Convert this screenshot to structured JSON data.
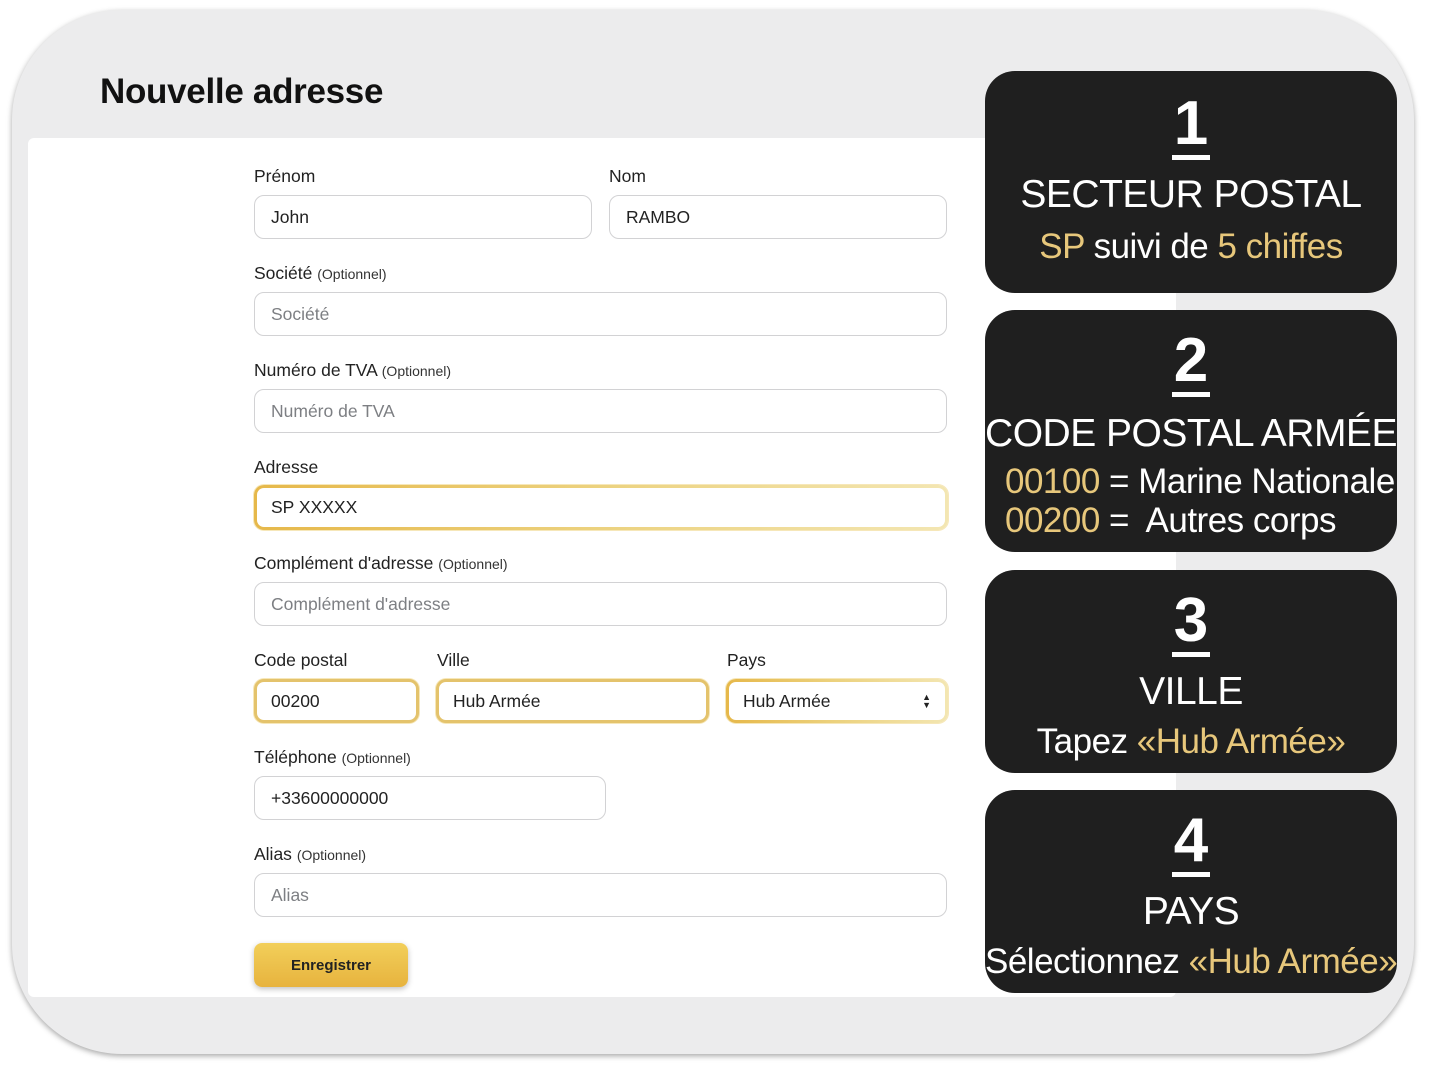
{
  "page": {
    "title": "Nouvelle adresse"
  },
  "colors": {
    "accent_gold": "#e7c77b",
    "card_bg": "#1f1f1f",
    "button_gold": "#ecc04b"
  },
  "form": {
    "firstname": {
      "label": "Prénom",
      "value": "John"
    },
    "lastname": {
      "label": "Nom",
      "value": "RAMBO"
    },
    "company": {
      "label": "Société",
      "optional": "(Optionnel)",
      "placeholder": "Société"
    },
    "vat": {
      "label": "Numéro de TVA",
      "optional": "(Optionnel)",
      "placeholder": "Numéro de TVA"
    },
    "address": {
      "label": "Adresse",
      "value": "SP XXXXX"
    },
    "address2": {
      "label": "Complément d'adresse",
      "optional": "(Optionnel)",
      "placeholder": "Complément d'adresse"
    },
    "postcode": {
      "label": "Code postal",
      "value": "00200"
    },
    "city": {
      "label": "Ville",
      "value": "Hub Armée"
    },
    "country": {
      "label": "Pays",
      "value": "Hub Armée"
    },
    "phone": {
      "label": "Téléphone",
      "optional": "(Optionnel)",
      "value": "+33600000000"
    },
    "alias": {
      "label": "Alias",
      "optional": "(Optionnel)",
      "placeholder": "Alias"
    },
    "save_label": "Enregistrer"
  },
  "cards": [
    {
      "number": "1",
      "title": "SECTEUR POSTAL",
      "line_a": "SP",
      "line_b": " suivi de ",
      "line_c": "5 chiffes"
    },
    {
      "number": "2",
      "title": "CODE POSTAL ARMÉE",
      "code1": "00100",
      "text1": " = Marine Nationale",
      "code2": "00200",
      "text2": " =  Autres corps"
    },
    {
      "number": "3",
      "title": "VILLE",
      "prefix": "Tapez ",
      "highlight": "«Hub Armée»"
    },
    {
      "number": "4",
      "title": "PAYS",
      "prefix": "Sélectionnez ",
      "highlight": "«Hub Armée»"
    }
  ]
}
